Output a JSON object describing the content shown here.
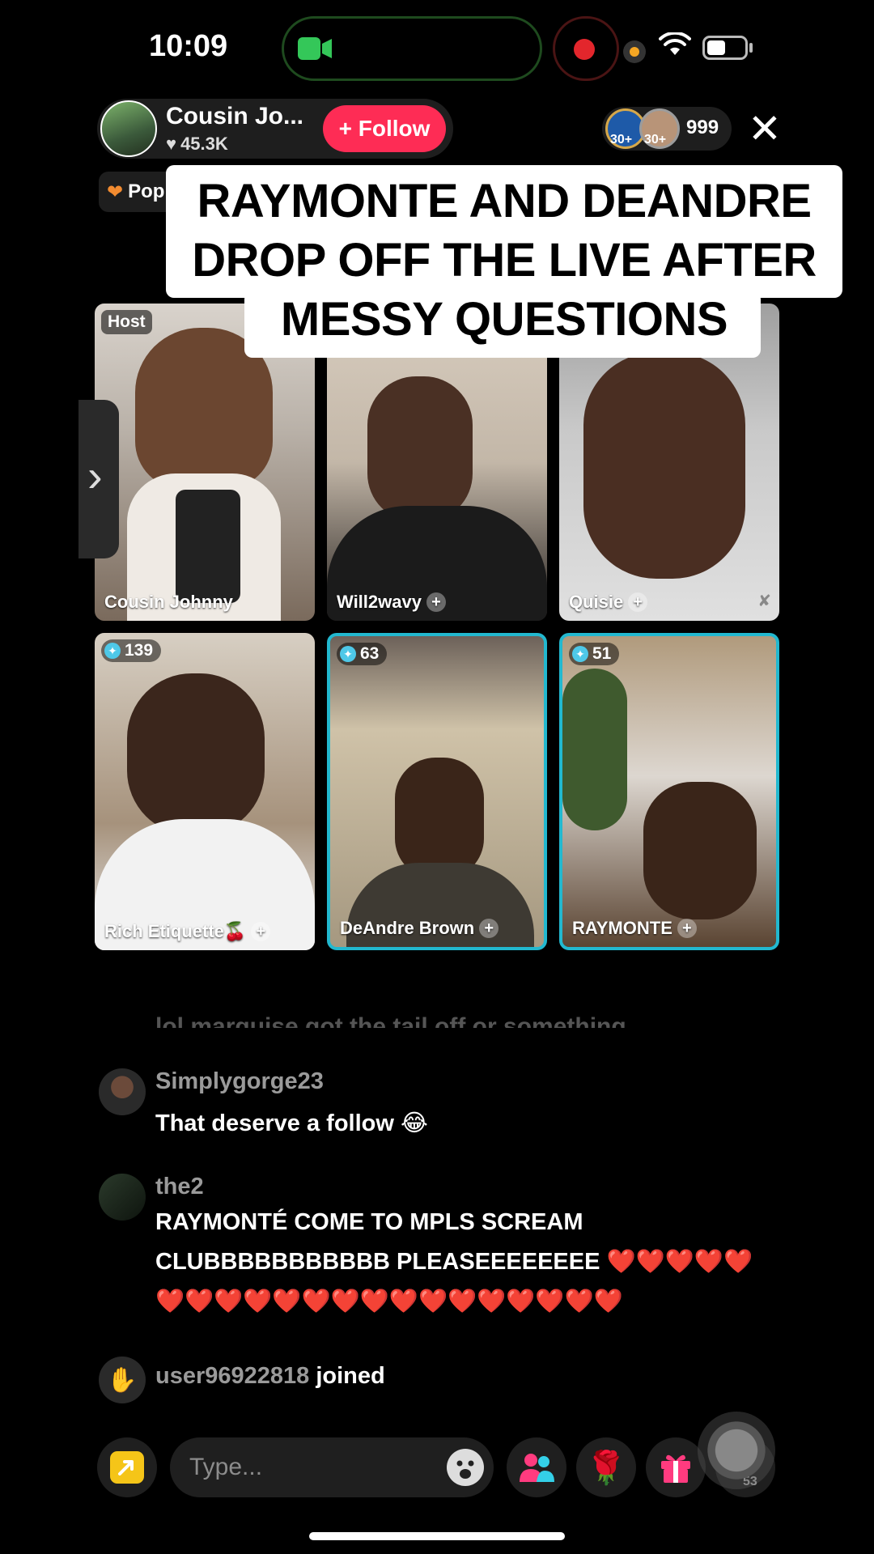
{
  "status_bar": {
    "time": "10:09"
  },
  "host": {
    "name": "Cousin Jo...",
    "likes": "45.3K",
    "follow_label": "+ Follow"
  },
  "viewers": {
    "badge1": "30+",
    "badge2": "30+",
    "count": "999"
  },
  "popular_label": "Pop",
  "caption": [
    "RAYMONTE AND DEANDRE",
    "DROP OFF THE LIVE AFTER",
    "MESSY QUESTIONS"
  ],
  "tiles": [
    {
      "name": "Cousin Johnny",
      "badge": "Host"
    },
    {
      "name": "Will2wavy"
    },
    {
      "name": "Quisie"
    },
    {
      "name": "Rich Etiquette🍒",
      "score": "139"
    },
    {
      "name": "DeAndre Brown",
      "score": "63"
    },
    {
      "name": "RAYMONTE",
      "score": "51"
    }
  ],
  "comments": {
    "faded": "lol marquise got the tail off or something",
    "items": [
      {
        "user": "Simplygorge23",
        "text": "That deserve a follow 😂"
      },
      {
        "user": "the2",
        "line1": "RAYMONTÉ COME TO MPLS SCREAM",
        "line2": "CLUBBBBBBBBBBB PLEASEEEEEEEE ❤️❤️❤️❤️❤️",
        "line3": "❤️❤️❤️❤️❤️❤️❤️❤️❤️❤️❤️❤️❤️❤️❤️❤️"
      }
    ],
    "joined_user": "user96922818",
    "joined_text": " joined"
  },
  "bottom_bar": {
    "placeholder": "Type...",
    "share_count": "53"
  },
  "colors": {
    "accent_follow": "#fe2c55",
    "tile_selected": "#22b8cf",
    "share": "#f5c518"
  }
}
